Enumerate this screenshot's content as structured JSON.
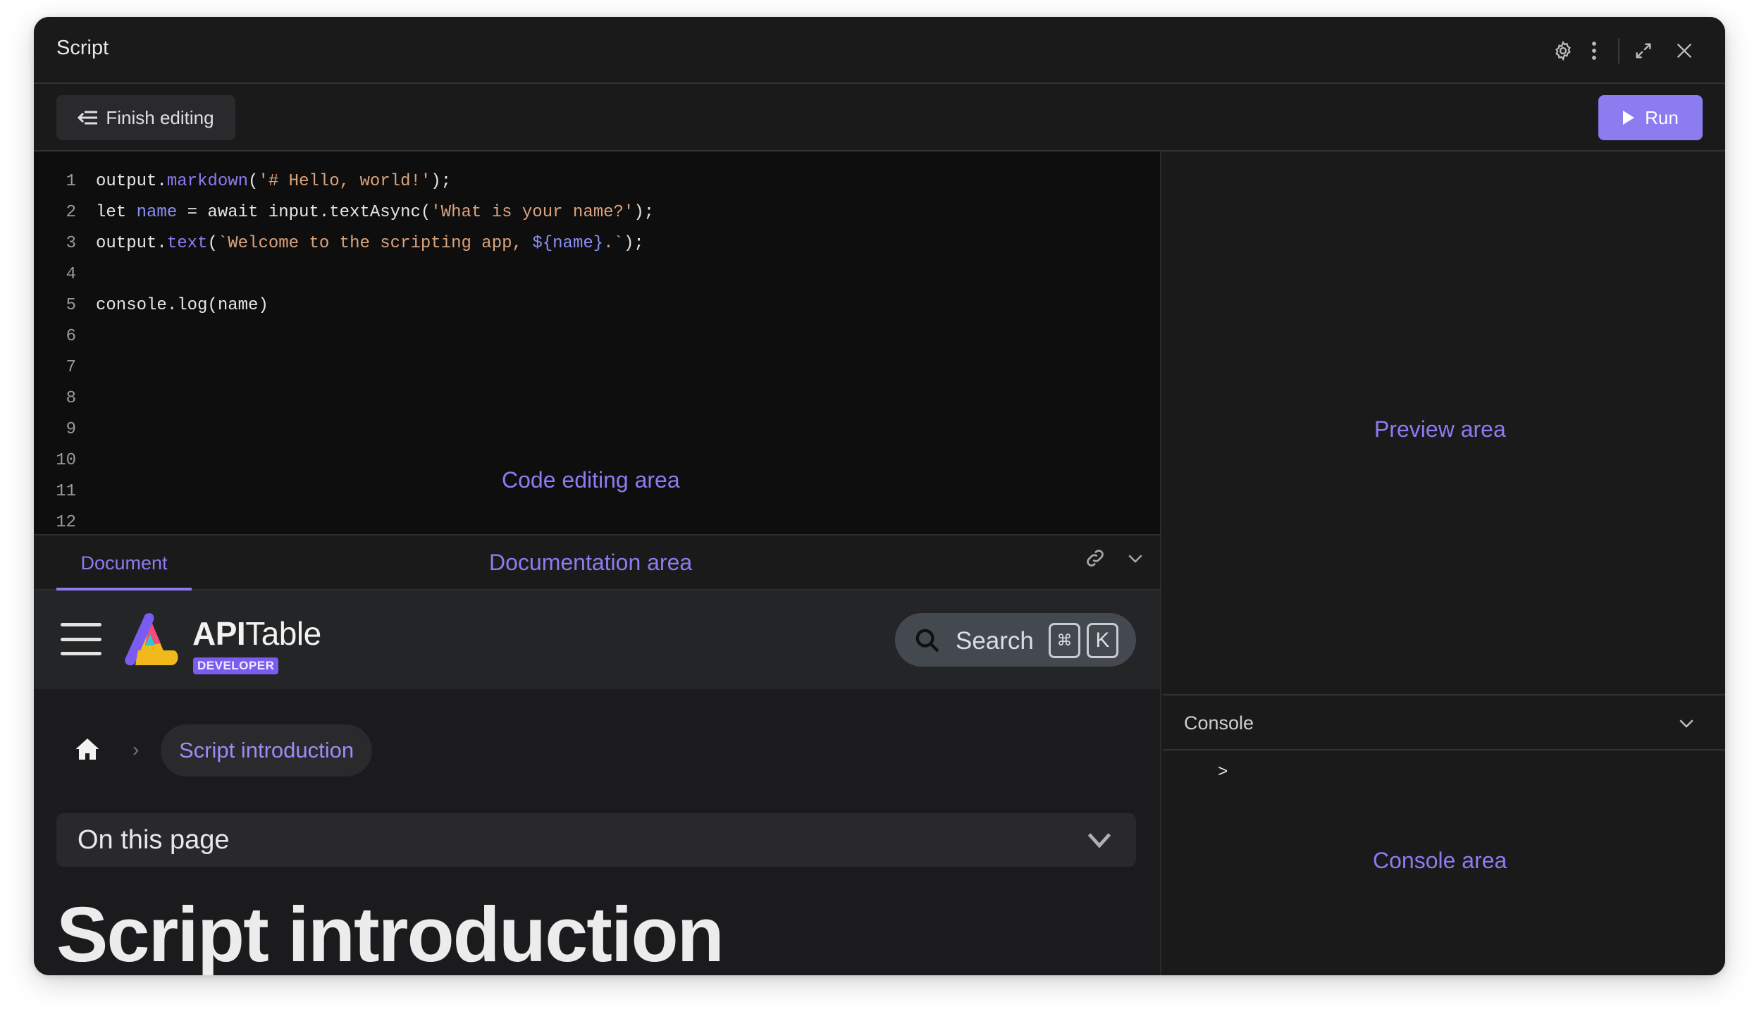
{
  "window": {
    "title": "Script",
    "icons": [
      "gear-icon",
      "more-vertical-icon",
      "expand-icon",
      "close-icon"
    ]
  },
  "toolbar": {
    "finish_label": "Finish editing",
    "run_label": "Run",
    "accent_color": "#8b7cf0"
  },
  "editor": {
    "area_label": "Code editing area",
    "lines": [
      {
        "n": "1",
        "tokens": [
          {
            "t": "output.",
            "c": "plain"
          },
          {
            "t": "markdown",
            "c": "fn"
          },
          {
            "t": "(",
            "c": "plain"
          },
          {
            "t": "'# Hello, world!'",
            "c": "str"
          },
          {
            "t": ");",
            "c": "plain"
          }
        ]
      },
      {
        "n": "2",
        "tokens": [
          {
            "t": "let ",
            "c": "plain"
          },
          {
            "t": "name",
            "c": "var"
          },
          {
            "t": " = await input.textAsync(",
            "c": "plain"
          },
          {
            "t": "'What is your name?'",
            "c": "str"
          },
          {
            "t": ");",
            "c": "plain"
          }
        ]
      },
      {
        "n": "3",
        "tokens": [
          {
            "t": "output.",
            "c": "plain"
          },
          {
            "t": "text",
            "c": "fn"
          },
          {
            "t": "(",
            "c": "plain"
          },
          {
            "t": "`Welcome to the scripting app, ",
            "c": "str"
          },
          {
            "t": "${name}",
            "c": "var"
          },
          {
            "t": ".`",
            "c": "str"
          },
          {
            "t": ");",
            "c": "plain"
          }
        ]
      },
      {
        "n": "4",
        "tokens": []
      },
      {
        "n": "5",
        "tokens": [
          {
            "t": "console.log(name)",
            "c": "plain"
          }
        ]
      },
      {
        "n": "6",
        "tokens": []
      },
      {
        "n": "7",
        "tokens": []
      },
      {
        "n": "8",
        "tokens": []
      },
      {
        "n": "9",
        "tokens": []
      },
      {
        "n": "10",
        "tokens": []
      },
      {
        "n": "11",
        "tokens": []
      },
      {
        "n": "12",
        "tokens": []
      }
    ]
  },
  "docs": {
    "tab_label": "Document",
    "area_label": "Documentation area",
    "brand_bold": "API",
    "brand_light": "Table",
    "badge": "DEVELOPER",
    "search_placeholder": "Search",
    "kbd_cmd": "⌘",
    "kbd_k": "K",
    "breadcrumb_current": "Script introduction",
    "breadcrumb_sep": "›",
    "on_this_page": "On this page",
    "heading": "Script introduction"
  },
  "preview": {
    "area_label": "Preview area"
  },
  "console": {
    "title": "Console",
    "prompt": ">",
    "area_label": "Console area"
  }
}
